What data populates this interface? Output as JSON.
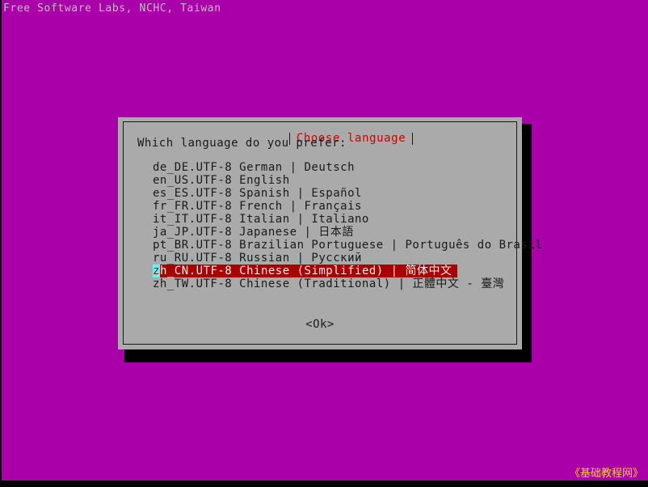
{
  "screen": {
    "background_color": "#aa00aa",
    "banner": "Free Software Labs, NCHC, Taiwan",
    "watermark": "《基础教程网》"
  },
  "dialog": {
    "title": "Choose language",
    "title_color": "#cc0000",
    "background_color": "#aaaaaa",
    "prompt": "Which language do you prefer:",
    "selection_bg_color": "#aa0000",
    "cursor_color": "#55ffff",
    "ok_label": "<Ok>",
    "languages": [
      {
        "locale": "de_DE.UTF-8",
        "text": "de_DE.UTF-8 German | Deutsch",
        "selected": false
      },
      {
        "locale": "en_US.UTF-8",
        "text": "en_US.UTF-8 English",
        "selected": false
      },
      {
        "locale": "es_ES.UTF-8",
        "text": "es_ES.UTF-8 Spanish | Español",
        "selected": false
      },
      {
        "locale": "fr_FR.UTF-8",
        "text": "fr_FR.UTF-8 French | Français",
        "selected": false
      },
      {
        "locale": "it_IT.UTF-8",
        "text": "it_IT.UTF-8 Italian | Italiano",
        "selected": false
      },
      {
        "locale": "ja_JP.UTF-8",
        "text": "ja_JP.UTF-8 Japanese | 日本語",
        "selected": false
      },
      {
        "locale": "pt_BR.UTF-8",
        "text": "pt_BR.UTF-8 Brazilian Portuguese | Português do Brasil",
        "selected": false
      },
      {
        "locale": "ru_RU.UTF-8",
        "text": "ru_RU.UTF-8 Russian | Русский",
        "selected": false
      },
      {
        "locale": "zh_CN.UTF-8",
        "text": "zh_CN.UTF-8 Chinese (Simplified) | 简体中文",
        "selected": true,
        "cursor_char": "z",
        "rest": "h_CN.UTF-8 Chinese (Simplified) | 简体中文"
      },
      {
        "locale": "zh_TW.UTF-8",
        "text": "zh_TW.UTF-8 Chinese (Traditional) | 正體中文 - 臺灣",
        "selected": false
      }
    ]
  }
}
